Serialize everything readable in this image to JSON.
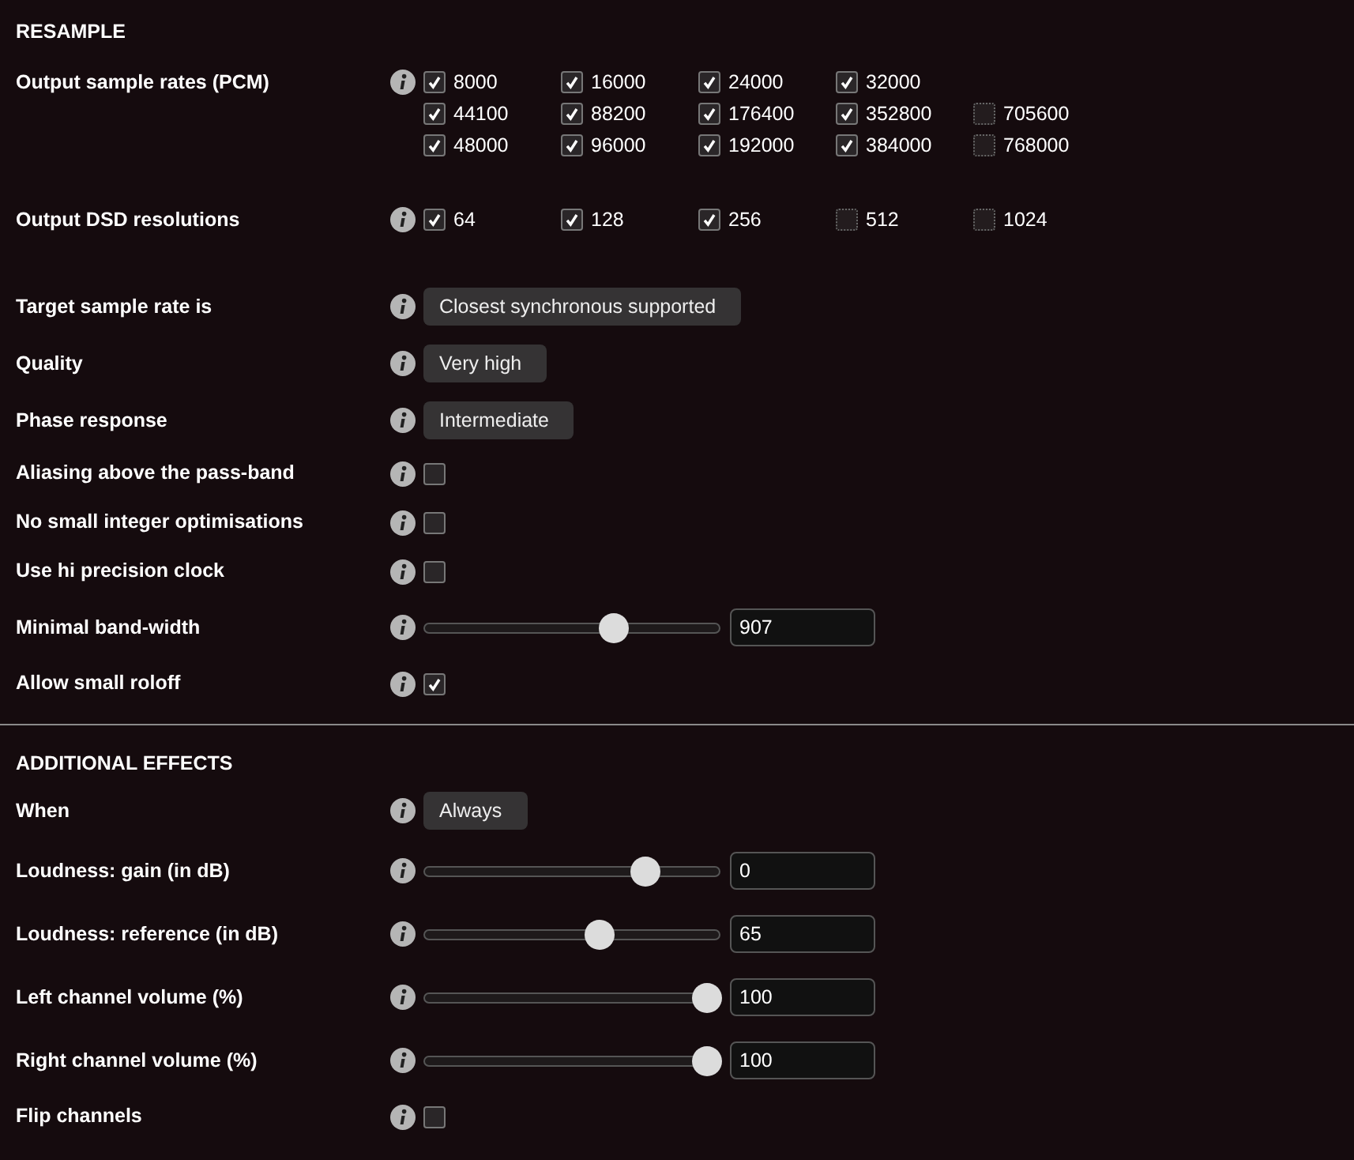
{
  "sections": [
    {
      "title": "RESAMPLE",
      "rows": [
        {
          "kind": "checkgrid",
          "label": "Output sample rates (PCM)",
          "lines": [
            [
              {
                "label": "8000",
                "checked": true,
                "disabled": false
              },
              {
                "label": "16000",
                "checked": true,
                "disabled": false
              },
              {
                "label": "24000",
                "checked": true,
                "disabled": false
              },
              {
                "label": "32000",
                "checked": true,
                "disabled": false
              }
            ],
            [
              {
                "label": "44100",
                "checked": true,
                "disabled": false
              },
              {
                "label": "88200",
                "checked": true,
                "disabled": false
              },
              {
                "label": "176400",
                "checked": true,
                "disabled": false
              },
              {
                "label": "352800",
                "checked": true,
                "disabled": false
              },
              {
                "label": "705600",
                "checked": false,
                "disabled": true
              }
            ],
            [
              {
                "label": "48000",
                "checked": true,
                "disabled": false
              },
              {
                "label": "96000",
                "checked": true,
                "disabled": false
              },
              {
                "label": "192000",
                "checked": true,
                "disabled": false
              },
              {
                "label": "384000",
                "checked": true,
                "disabled": false
              },
              {
                "label": "768000",
                "checked": false,
                "disabled": true
              }
            ]
          ]
        },
        {
          "kind": "checkgrid",
          "label": "Output DSD resolutions",
          "lines": [
            [
              {
                "label": "64",
                "checked": true,
                "disabled": false
              },
              {
                "label": "128",
                "checked": true,
                "disabled": false
              },
              {
                "label": "256",
                "checked": true,
                "disabled": false
              },
              {
                "label": "512",
                "checked": false,
                "disabled": true
              },
              {
                "label": "1024",
                "checked": false,
                "disabled": true
              }
            ]
          ]
        },
        {
          "kind": "select",
          "label": "Target sample rate is",
          "value": "Closest synchronous supported"
        },
        {
          "kind": "select",
          "label": "Quality",
          "value": "Very high"
        },
        {
          "kind": "select",
          "label": "Phase response",
          "value": "Intermediate"
        },
        {
          "kind": "checkbox",
          "label": "Aliasing above the pass-band",
          "checked": false
        },
        {
          "kind": "checkbox",
          "label": "No small integer optimisations",
          "checked": false
        },
        {
          "kind": "checkbox",
          "label": "Use hi precision clock",
          "checked": false
        },
        {
          "kind": "slider",
          "label": "Minimal band-width",
          "level": 0.65,
          "value": "907"
        },
        {
          "kind": "checkbox",
          "label": "Allow small roloff",
          "checked": true
        }
      ]
    },
    {
      "title": "ADDITIONAL EFFECTS",
      "rows": [
        {
          "kind": "select",
          "label": "When",
          "value": "Always"
        },
        {
          "kind": "slider",
          "label": "Loudness: gain (in dB)",
          "level": 0.77,
          "value": "0"
        },
        {
          "kind": "slider",
          "label": "Loudness: reference (in dB)",
          "level": 0.6,
          "value": "65"
        },
        {
          "kind": "slider",
          "label": "Left channel volume (%)",
          "level": 1,
          "value": "100"
        },
        {
          "kind": "slider",
          "label": "Right channel volume (%)",
          "level": 1,
          "value": "100"
        },
        {
          "kind": "checkbox",
          "label": "Flip channels",
          "checked": false
        }
      ]
    }
  ]
}
